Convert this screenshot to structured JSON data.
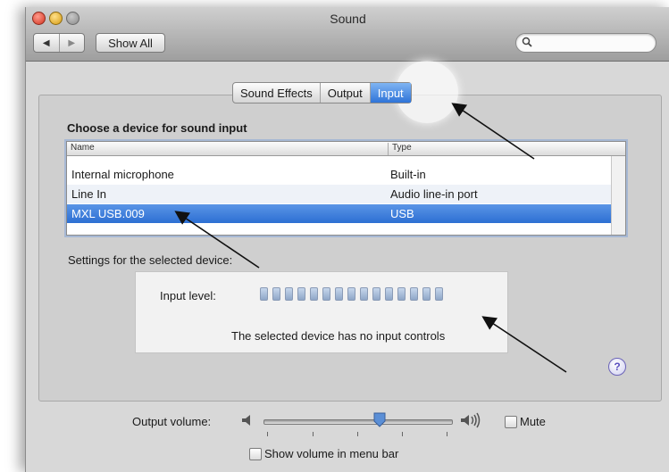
{
  "window": {
    "title": "Sound"
  },
  "toolbar": {
    "back_icon": "◀",
    "forward_icon": "▶",
    "show_all_label": "Show All",
    "search_placeholder": ""
  },
  "tabs": [
    {
      "label": "Sound Effects",
      "active": false
    },
    {
      "label": "Output",
      "active": false
    },
    {
      "label": "Input",
      "active": true
    }
  ],
  "input_pane": {
    "section_title": "Choose a device for sound input",
    "columns": [
      "Name",
      "Type"
    ],
    "devices": [
      {
        "name": "Internal microphone",
        "type": "Built-in",
        "selected": false
      },
      {
        "name": "Line In",
        "type": "Audio line-in port",
        "selected": false
      },
      {
        "name": "MXL USB.009",
        "type": "USB",
        "selected": true
      }
    ],
    "settings_label": "Settings for the selected device:",
    "input_level_label": "Input level:",
    "input_level_segments": 15,
    "input_level_value": 0,
    "no_controls_message": "The selected device has no input controls",
    "help_label": "?"
  },
  "output_volume": {
    "label": "Output volume:",
    "value_fraction": 0.62,
    "mute_label": "Mute",
    "mute_checked": false
  },
  "menu_bar_volume": {
    "label": "Show volume in menu bar",
    "checked": false
  },
  "colors": {
    "selection_blue": "#2d6fd3",
    "tab_active_blue": "#2f74d8",
    "help_purple": "#5a4fbf"
  },
  "icons": {
    "search": "magnifier-icon",
    "speaker_low": "speaker-low-icon",
    "speaker_high": "speaker-high-icon",
    "help": "help-icon",
    "annotation_arrow": "arrow-annotation"
  }
}
